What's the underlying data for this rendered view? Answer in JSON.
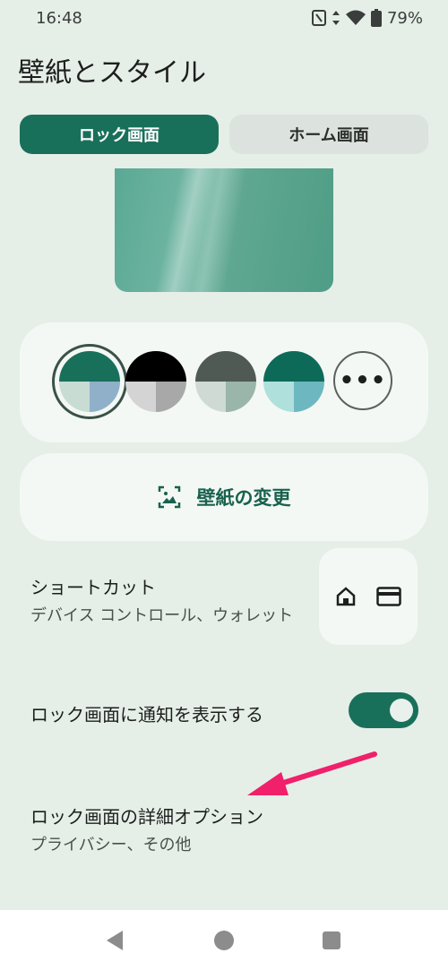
{
  "status": {
    "time": "16:48",
    "battery": "79%"
  },
  "page": {
    "title": "壁紙とスタイル"
  },
  "tabs": [
    {
      "label": "ロック画面",
      "active": true
    },
    {
      "label": "ホーム画面",
      "active": false
    }
  ],
  "swatches": [
    {
      "top": "#19705a",
      "bl": "#c8dcd4",
      "br": "#8fb0c8",
      "selected": true
    },
    {
      "top": "#000000",
      "bl": "#d4d4d4",
      "br": "#a8a8a8",
      "selected": false
    },
    {
      "top": "#505a55",
      "bl": "#d0dad5",
      "br": "#9ab5aa",
      "selected": false
    },
    {
      "top": "#0e6a58",
      "bl": "#b0e0dc",
      "br": "#6db8c0",
      "selected": false
    }
  ],
  "more_button": {
    "label": "•••"
  },
  "wallpaper_button": {
    "label": "壁紙の変更"
  },
  "shortcut": {
    "title": "ショートカット",
    "subtitle": "デバイス コントロール、ウォレット"
  },
  "notifications": {
    "title": "ロック画面に通知を表示する",
    "enabled": true
  },
  "details": {
    "title": "ロック画面の詳細オプション",
    "subtitle": "プライバシー、その他"
  },
  "colors": {
    "accent": "#19705a",
    "annotation_arrow": "#f0206a"
  }
}
